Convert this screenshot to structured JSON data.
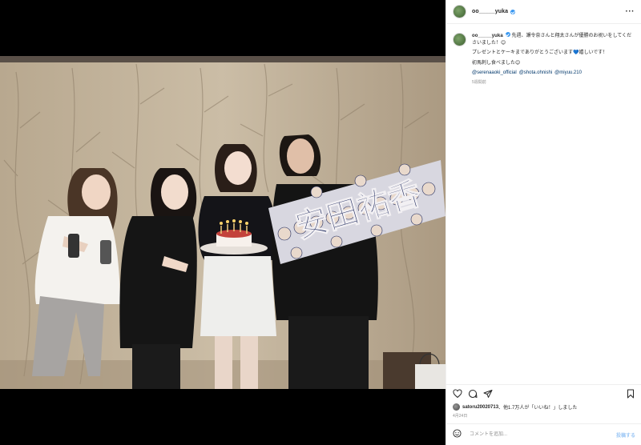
{
  "post": {
    "username": "oo_____yuka",
    "verified": true,
    "more_icon": "more-horizontal-icon",
    "caption_lines": [
      "先週、瀬令奈さんと翔太さんが優勝のお祝いをしてくださいました！",
      "プレゼントとケーキまでありがとうございます",
      "嬉しいです！",
      "初馬刺し食べました"
    ],
    "mentions": [
      "@serenaaoki_official",
      "@shota.ohnishi",
      "@miyuu.210"
    ],
    "age": "5週間前",
    "likes_user": "satoru20020713",
    "likes_text": "、他1.7万人が「いいね！」しました",
    "date": "4月24日",
    "comment_placeholder": "コメントを追加...",
    "post_label": "投稿する",
    "colors": {
      "verified": "#3897f0",
      "link": "#00376b",
      "post_disabled": "#9ec8f5"
    },
    "icons": [
      "heart-icon",
      "comment-icon",
      "share-icon",
      "bookmark-icon",
      "emoji-icon"
    ]
  },
  "photo": {
    "banner_text": "安田祐香"
  }
}
